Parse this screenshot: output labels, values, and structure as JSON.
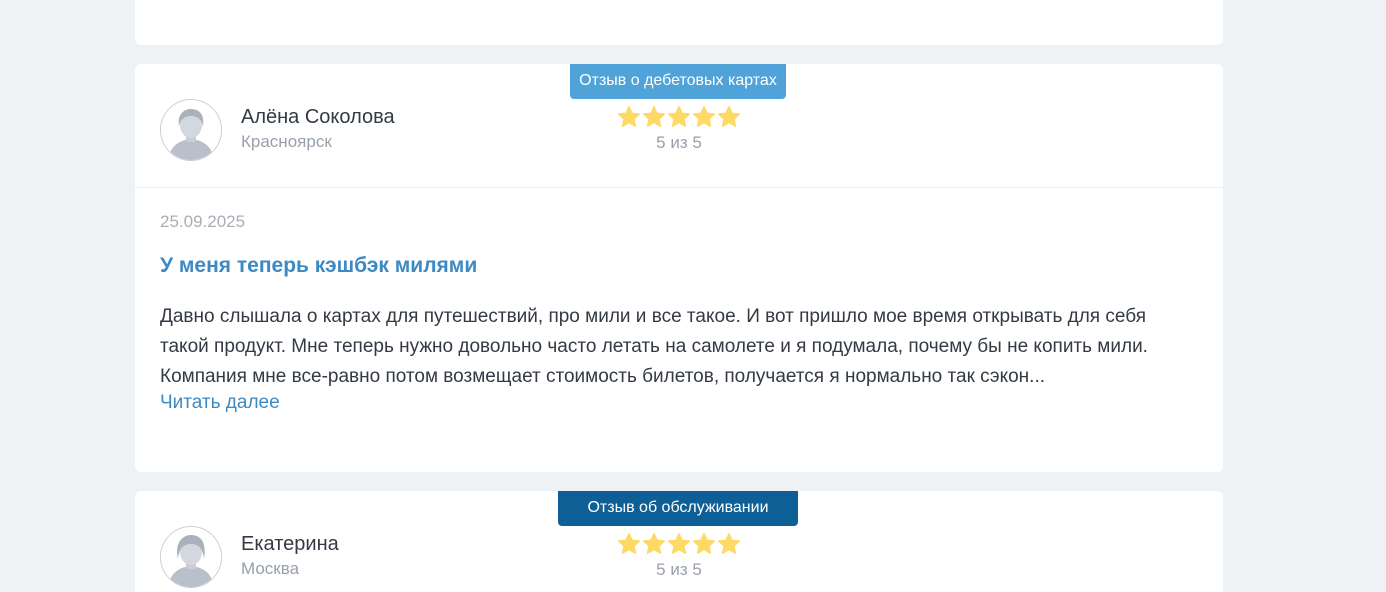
{
  "reviews": [
    {
      "category": "Отзыв о дебетовых картах",
      "category_color": "#4fa3d8",
      "author": "Алёна Соколова",
      "city": "Красноярск",
      "rating": 5,
      "rating_text": "5 из 5",
      "date": "25.09.2025",
      "title": "У меня теперь кэшбэк милями",
      "text": "Давно слышала о картах для путешествий, про мили и все такое. И вот пришло мое время открывать для себя такой продукт. Мне теперь нужно довольно часто летать на самолете и я подумала, почему бы не копить мили. Компания мне все-равно потом возмещает стоимость билетов, получается я нормально так сэкон...",
      "read_more": "Читать далее"
    },
    {
      "category": "Отзыв об обслуживании",
      "category_color": "#0f5f97",
      "author": "Екатерина",
      "city": "Москва",
      "rating": 5,
      "rating_text": "5 из 5"
    }
  ],
  "colors": {
    "background": "#eff2f5",
    "accent": "#3d8ac3",
    "star": "#ffd966"
  }
}
